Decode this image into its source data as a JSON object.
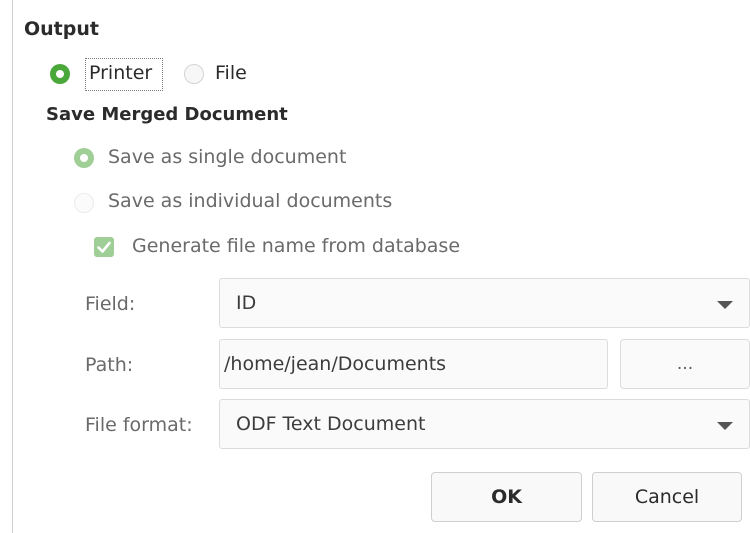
{
  "output": {
    "heading": "Output",
    "options": [
      {
        "label": "Printer",
        "selected": true
      },
      {
        "label": "File",
        "selected": false
      }
    ]
  },
  "save_merged": {
    "heading": "Save Merged Document",
    "options": [
      {
        "label": "Save as single document",
        "selected": true
      },
      {
        "label": "Save as individual documents",
        "selected": false
      }
    ],
    "generate_checkbox": {
      "label": "Generate file name from database",
      "checked": true
    },
    "field": {
      "label": "Field:",
      "value": "ID"
    },
    "path": {
      "label": "Path:",
      "value": "/home/jean/Documents",
      "browse_label": "..."
    },
    "file_format": {
      "label": "File format:",
      "value": "ODF Text Document"
    }
  },
  "buttons": {
    "ok": "OK",
    "cancel": "Cancel"
  },
  "colors": {
    "accent": "#4aa83b",
    "accent_disabled": "#9fcf96"
  }
}
